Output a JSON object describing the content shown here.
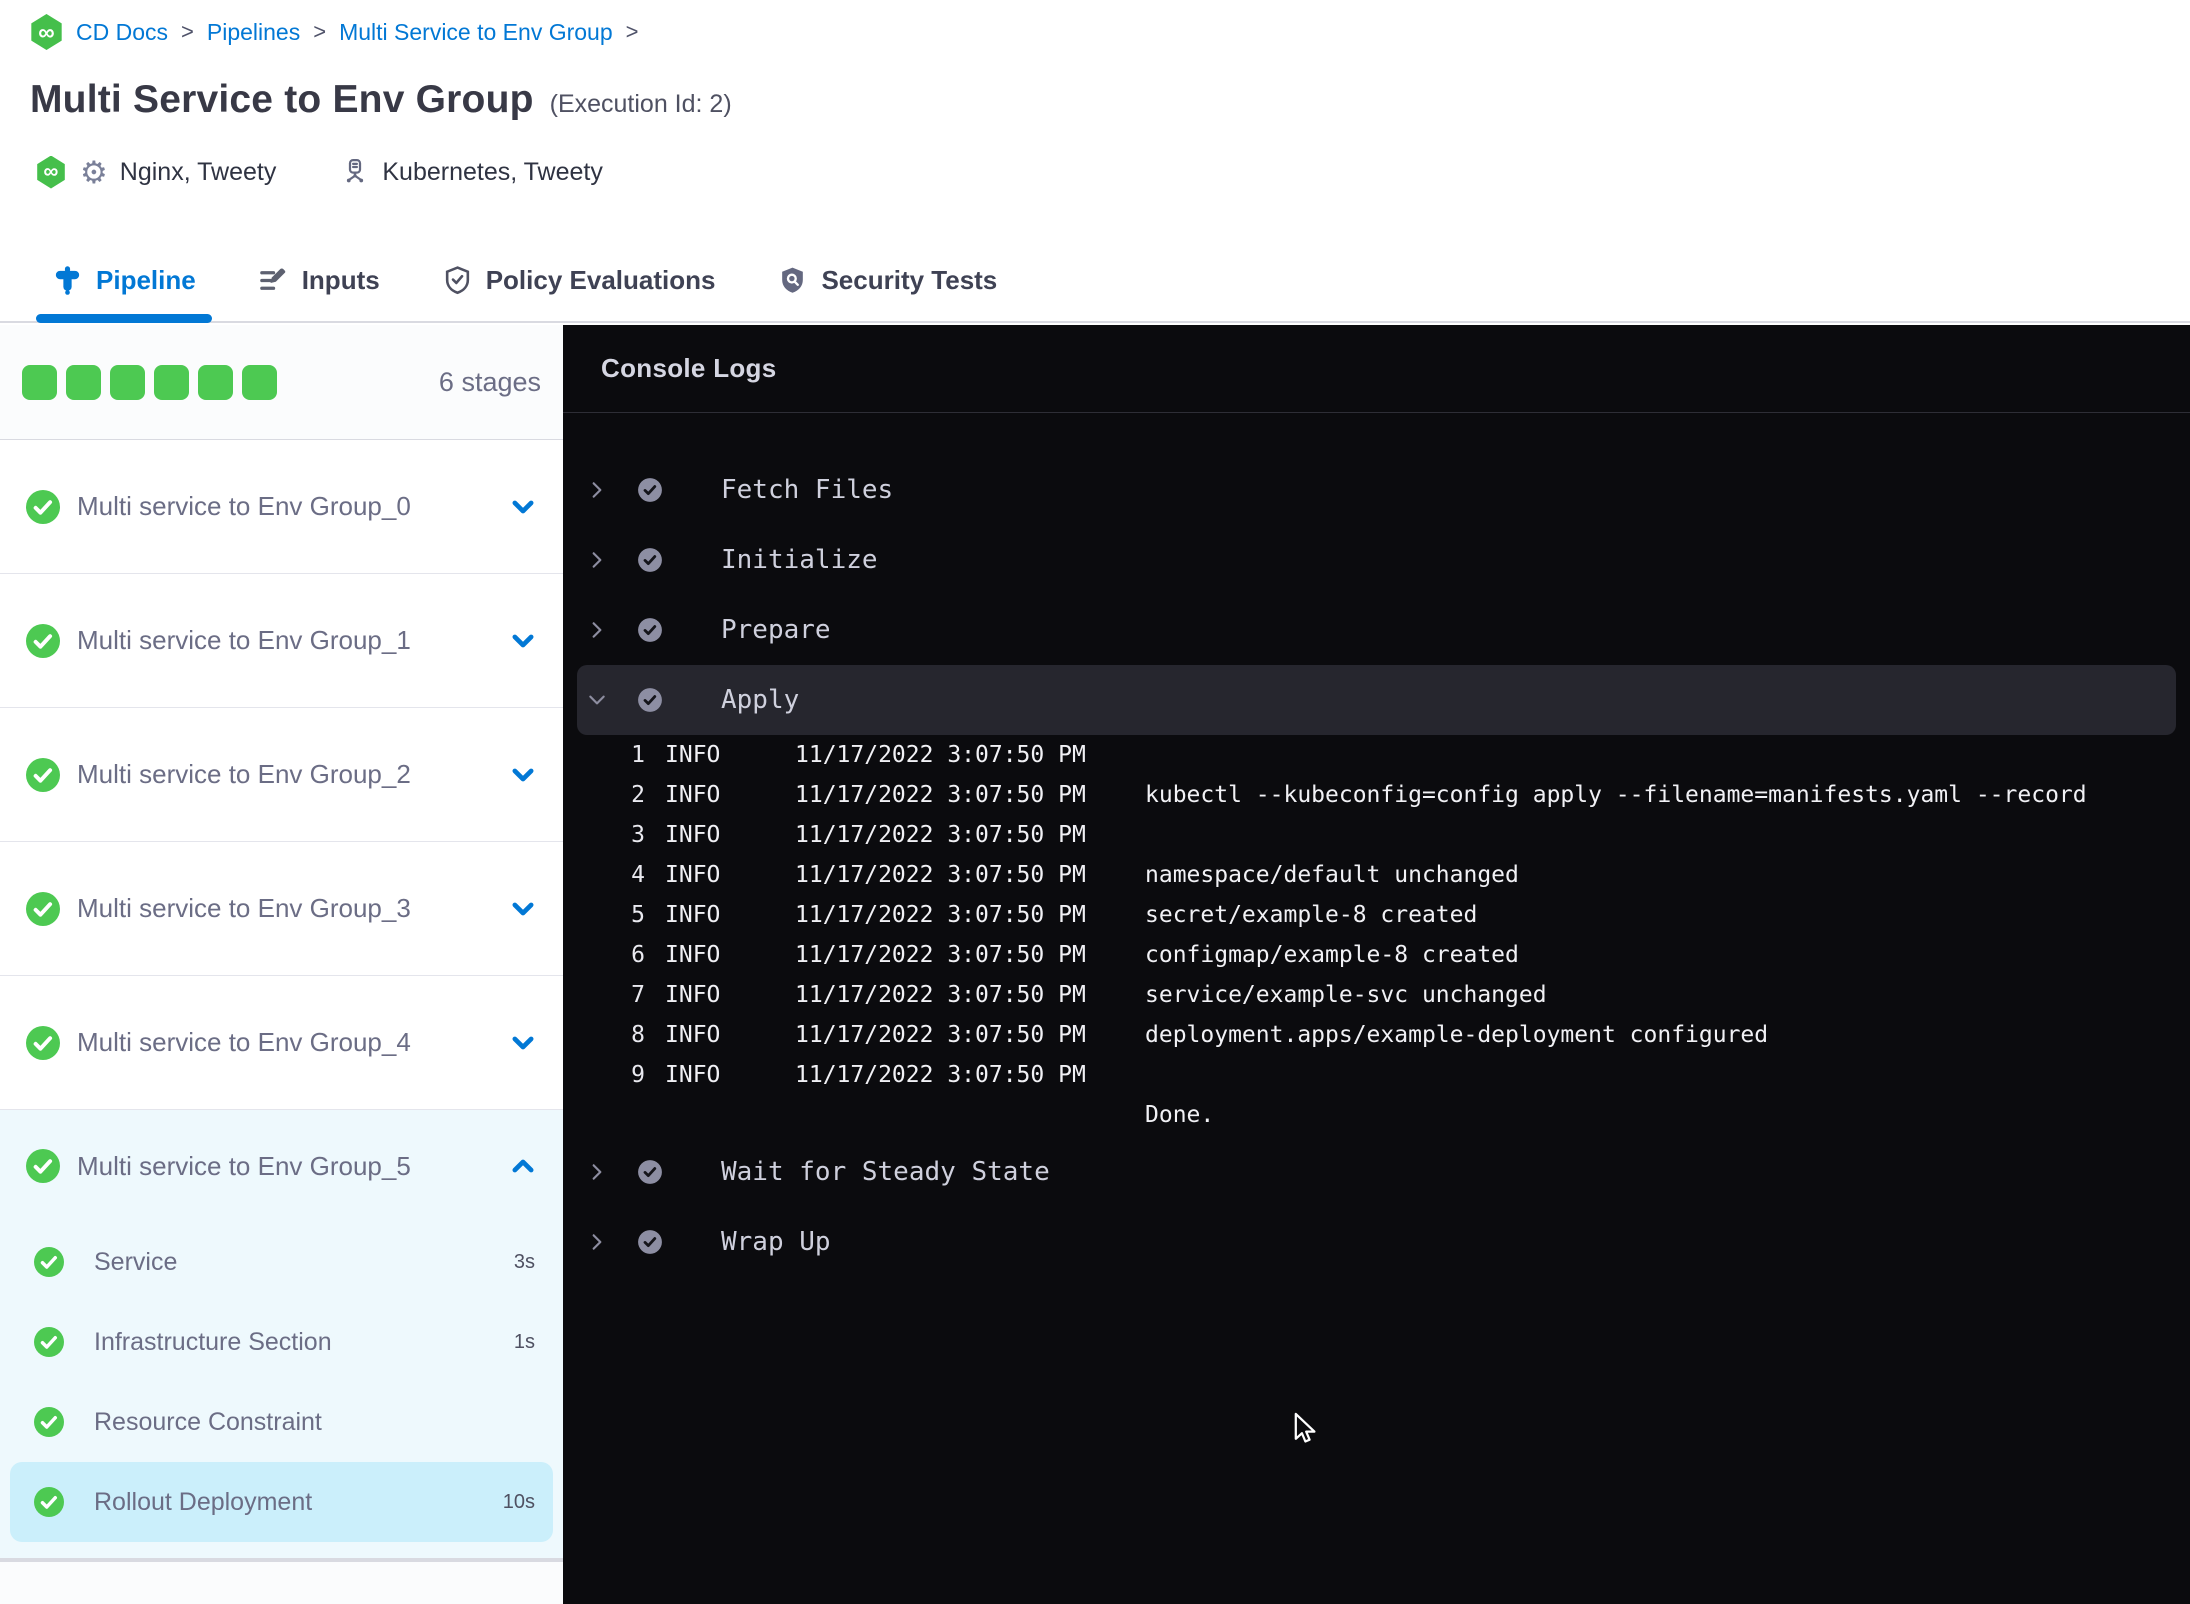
{
  "colors": {
    "accent_blue": "#0278d5",
    "success_green": "#4dc952",
    "console_bg": "#0b0b0e",
    "expanded_stage_bg": "#eef9fd",
    "selected_step_bg": "#cbeffb"
  },
  "breadcrumb": {
    "items": [
      "CD Docs",
      "Pipelines",
      "Multi Service to Env Group"
    ],
    "separator": ">"
  },
  "header": {
    "title": "Multi Service to Env Group",
    "execution_label": "(Execution Id: 2)",
    "services_label": "Nginx, Tweety",
    "environments_label": "Kubernetes, Tweety"
  },
  "tabs": [
    {
      "label": "Pipeline",
      "active": true
    },
    {
      "label": "Inputs",
      "active": false
    },
    {
      "label": "Policy Evaluations",
      "active": false
    },
    {
      "label": "Security Tests",
      "active": false
    }
  ],
  "sidebar": {
    "stages_count_label": "6 stages",
    "progress_squares": 6,
    "stages": [
      {
        "label": "Multi service to Env Group_0",
        "status": "success",
        "expanded": false
      },
      {
        "label": "Multi service to Env Group_1",
        "status": "success",
        "expanded": false
      },
      {
        "label": "Multi service to Env Group_2",
        "status": "success",
        "expanded": false
      },
      {
        "label": "Multi service to Env Group_3",
        "status": "success",
        "expanded": false
      },
      {
        "label": "Multi service to Env Group_4",
        "status": "success",
        "expanded": false
      },
      {
        "label": "Multi service to Env Group_5",
        "status": "success",
        "expanded": true
      }
    ],
    "substeps": [
      {
        "label": "Service",
        "duration": "3s",
        "status": "success",
        "selected": false
      },
      {
        "label": "Infrastructure Section",
        "duration": "1s",
        "status": "success",
        "selected": false
      },
      {
        "label": "Resource Constraint",
        "duration": "",
        "status": "success",
        "selected": false
      },
      {
        "label": "Rollout Deployment",
        "duration": "10s",
        "status": "success",
        "selected": true
      }
    ]
  },
  "console": {
    "title": "Console Logs",
    "steps": [
      {
        "label": "Fetch Files",
        "status": "success",
        "expanded": false
      },
      {
        "label": "Initialize",
        "status": "success",
        "expanded": false
      },
      {
        "label": "Prepare",
        "status": "success",
        "expanded": false
      },
      {
        "label": "Apply",
        "status": "success",
        "expanded": true
      },
      {
        "label": "Wait for Steady State",
        "status": "success",
        "expanded": false
      },
      {
        "label": "Wrap Up",
        "status": "success",
        "expanded": false
      }
    ],
    "logs": [
      {
        "num": "1",
        "level": "INFO",
        "time": "11/17/2022 3:07:50 PM",
        "message": ""
      },
      {
        "num": "2",
        "level": "INFO",
        "time": "11/17/2022 3:07:50 PM",
        "message": "kubectl --kubeconfig=config apply --filename=manifests.yaml --record"
      },
      {
        "num": "3",
        "level": "INFO",
        "time": "11/17/2022 3:07:50 PM",
        "message": ""
      },
      {
        "num": "4",
        "level": "INFO",
        "time": "11/17/2022 3:07:50 PM",
        "message": "namespace/default unchanged"
      },
      {
        "num": "5",
        "level": "INFO",
        "time": "11/17/2022 3:07:50 PM",
        "message": "secret/example-8 created"
      },
      {
        "num": "6",
        "level": "INFO",
        "time": "11/17/2022 3:07:50 PM",
        "message": "configmap/example-8 created"
      },
      {
        "num": "7",
        "level": "INFO",
        "time": "11/17/2022 3:07:50 PM",
        "message": "service/example-svc unchanged"
      },
      {
        "num": "8",
        "level": "INFO",
        "time": "11/17/2022 3:07:50 PM",
        "message": "deployment.apps/example-deployment configured"
      },
      {
        "num": "9",
        "level": "INFO",
        "time": "11/17/2022 3:07:50 PM",
        "message": ""
      },
      {
        "num": "",
        "level": "",
        "time": "",
        "message": "Done."
      }
    ]
  }
}
